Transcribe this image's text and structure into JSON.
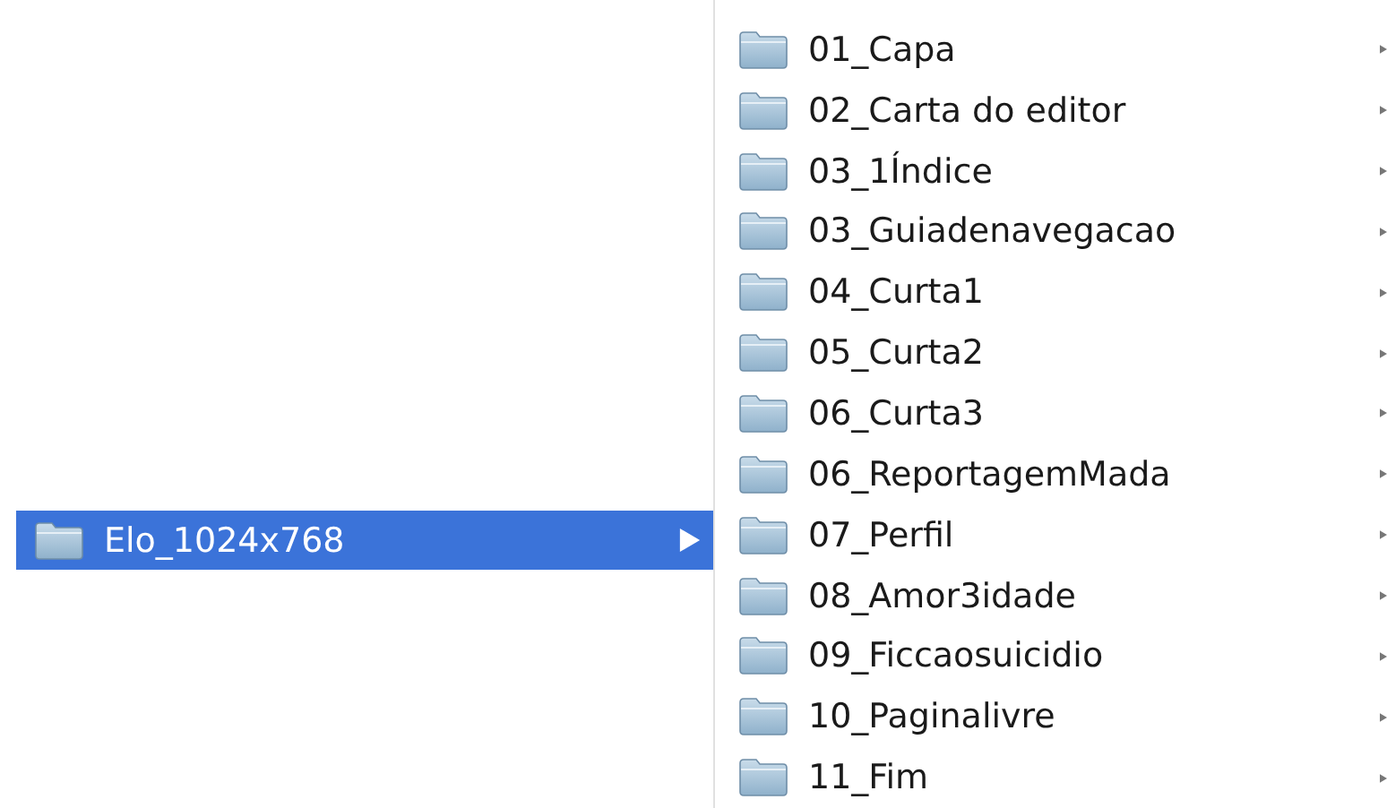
{
  "columns": [
    {
      "items": [
        {
          "name": "Elo_1024x768",
          "selected": true
        }
      ]
    },
    {
      "items": [
        {
          "name": "01_Capa",
          "selected": false
        },
        {
          "name": "02_Carta do editor",
          "selected": false
        },
        {
          "name": "03_1Índice",
          "selected": false
        },
        {
          "name": "03_Guiadenavegacao",
          "selected": false
        },
        {
          "name": "04_Curta1",
          "selected": false
        },
        {
          "name": "05_Curta2",
          "selected": false
        },
        {
          "name": "06_Curta3",
          "selected": false
        },
        {
          "name": "06_ReportagemMada",
          "selected": false
        },
        {
          "name": "07_Perfil",
          "selected": false
        },
        {
          "name": "08_Amor3idade",
          "selected": false
        },
        {
          "name": "09_Ficcaosuicidio",
          "selected": false
        },
        {
          "name": "10_Paginalivre",
          "selected": false
        },
        {
          "name": "11_Fim",
          "selected": false
        }
      ]
    }
  ]
}
